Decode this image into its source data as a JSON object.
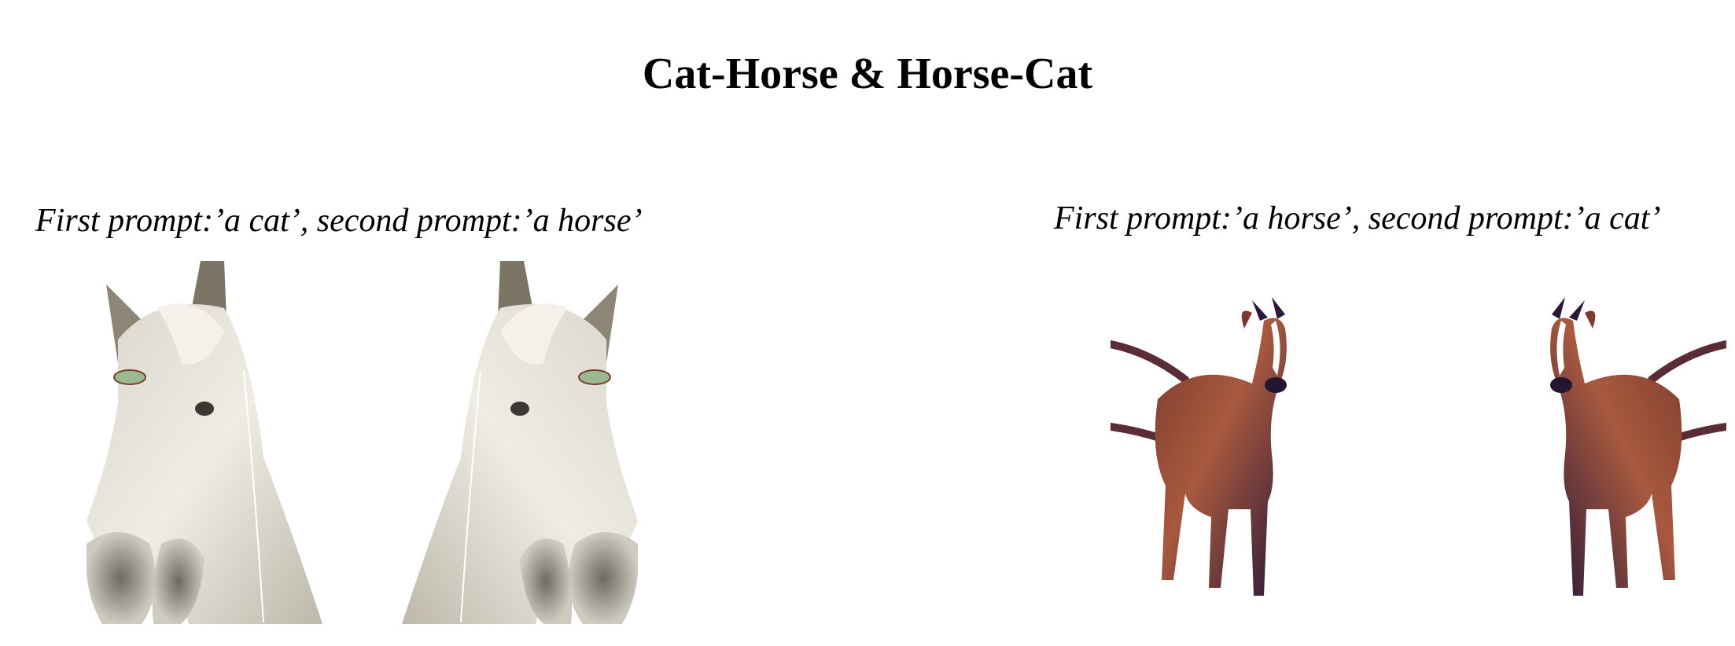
{
  "title": "Cat-Horse & Horse-Cat",
  "panels": [
    {
      "caption": "First prompt:’a cat’, second prompt:’a horse’",
      "images": [
        "cat-horse-image",
        "cat-horse-image-mirrored"
      ]
    },
    {
      "caption": "First prompt:’a horse’, second prompt:’a cat’",
      "images": [
        "horse-cat-image",
        "horse-cat-image-mirrored"
      ]
    }
  ]
}
